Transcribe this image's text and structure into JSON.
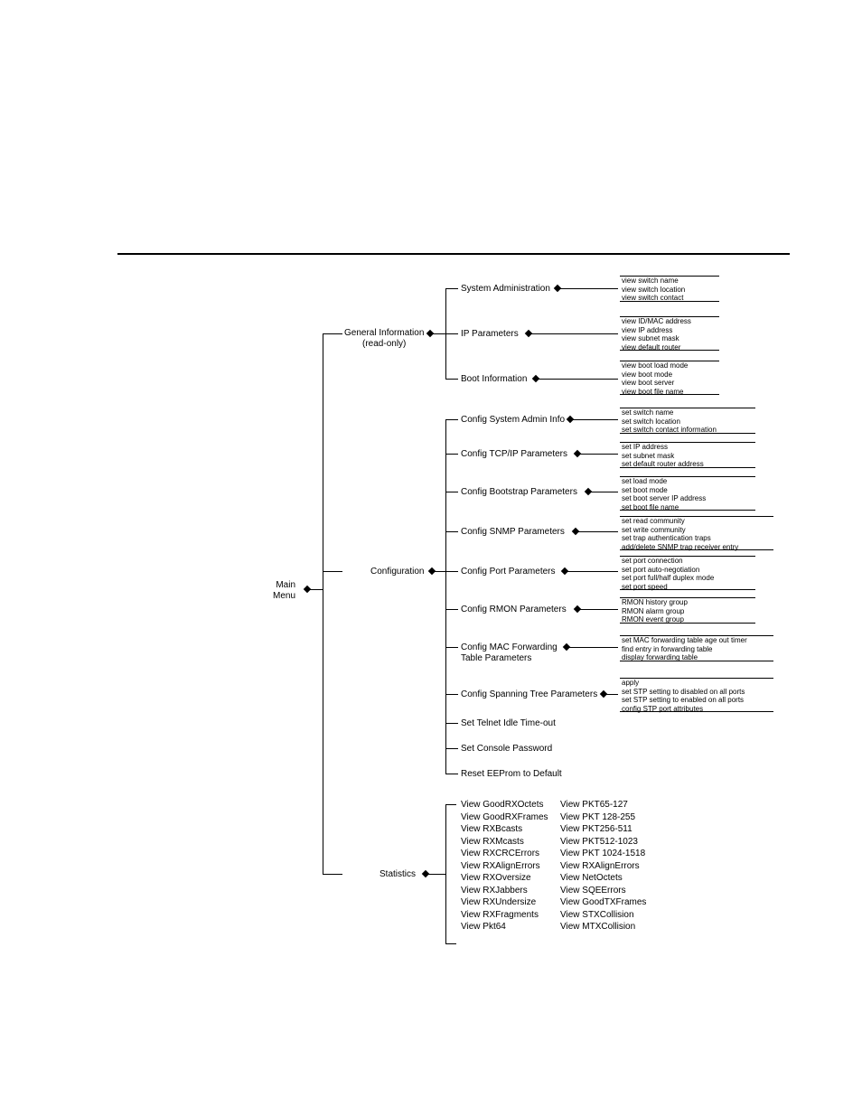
{
  "root": {
    "line1": "Main",
    "line2": "Menu"
  },
  "l1": {
    "general": {
      "line1": "General Information",
      "line2": "(read-only)"
    },
    "config": "Configuration",
    "stats": "Statistics"
  },
  "general_sub": {
    "sysadmin": "System Administration",
    "ip": "IP Parameters",
    "boot": "Boot Information"
  },
  "general_leaf": {
    "sysadmin": [
      "view switch name",
      "view switch location",
      "view switch contact"
    ],
    "ip": [
      "view ID/MAC address",
      "view IP address",
      "view subnet mask",
      "view default router"
    ],
    "boot": [
      "view boot load mode",
      "view boot mode",
      "view boot server",
      "view boot file name"
    ]
  },
  "config_sub": {
    "sysadmin": "Config System Admin Info",
    "tcpip": "Config TCP/IP Parameters",
    "bootstrap": "Config Bootstrap Parameters",
    "snmp": "Config SNMP Parameters",
    "port": "Config Port Parameters",
    "rmon": "Config RMON Parameters",
    "mac1": "Config MAC Forwarding",
    "mac2": "Table Parameters",
    "stp": "Config Spanning Tree Parameters",
    "telnet": "Set Telnet Idle Time-out",
    "console": "Set Console Password",
    "eeprom": "Reset EEProm to Default"
  },
  "config_leaf": {
    "sysadmin": [
      "set switch name",
      "set switch location",
      "set switch contact information"
    ],
    "tcpip": [
      "set IP address",
      "set subnet mask",
      "set default router address"
    ],
    "bootstrap": [
      "set load mode",
      "set boot mode",
      "set boot server IP address",
      "set boot file name"
    ],
    "snmp": [
      "set read community",
      "set write community",
      "set trap authentication traps",
      "add/delete SNMP trap receiver entry"
    ],
    "port": [
      "set port connection",
      "set port auto-negotiation",
      "set port full/half duplex mode",
      "set port speed"
    ],
    "rmon": [
      "RMON history group",
      "RMON alarm group",
      "RMON event group"
    ],
    "mac": [
      "set MAC forwarding table age out timer",
      "find entry in forwarding table",
      "display forwarding table"
    ],
    "stp": [
      "apply",
      "set STP setting to disabled on all ports",
      "set STP setting to enabled on all ports",
      "config STP port attributes"
    ]
  },
  "stats": {
    "col1": [
      "View GoodRXOctets",
      "View GoodRXFrames",
      "View RXBcasts",
      "View RXMcasts",
      "View RXCRCErrors",
      "View RXAlignErrors",
      "View RXOversize",
      "View RXJabbers",
      "View RXUndersize",
      "View RXFragments",
      "View Pkt64"
    ],
    "col2": [
      "View PKT65-127",
      "View PKT 128-255",
      "View PKT256-511",
      "View PKT512-1023",
      "View PKT 1024-1518",
      "View RXAlignErrors",
      "View NetOctets",
      "View SQEErrors",
      "View GoodTXFrames",
      "View STXCollision",
      "View MTXCollision"
    ]
  }
}
